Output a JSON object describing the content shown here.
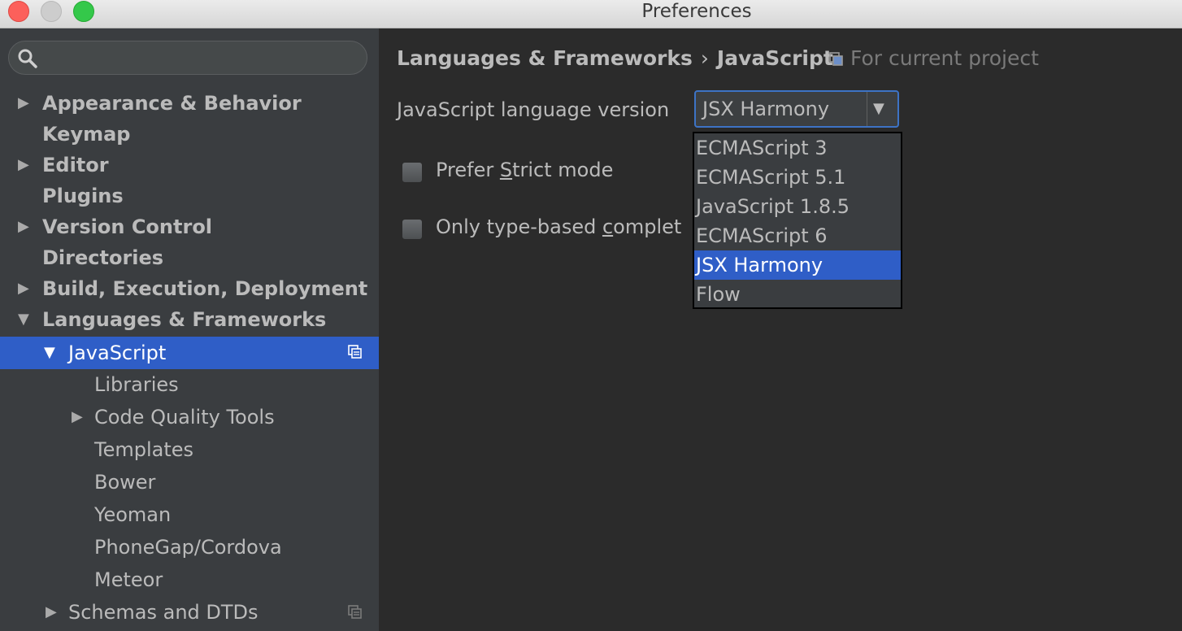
{
  "window": {
    "title": "Preferences"
  },
  "search": {
    "placeholder": ""
  },
  "sidebar": {
    "items": [
      {
        "label": "Appearance & Behavior",
        "arrow": "▶"
      },
      {
        "label": "Keymap",
        "arrow": ""
      },
      {
        "label": "Editor",
        "arrow": "▶"
      },
      {
        "label": "Plugins",
        "arrow": ""
      },
      {
        "label": "Version Control",
        "arrow": "▶"
      },
      {
        "label": "Directories",
        "arrow": ""
      },
      {
        "label": "Build, Execution, Deployment",
        "arrow": "▶"
      },
      {
        "label": "Languages & Frameworks",
        "arrow": "▼"
      },
      {
        "label": "JavaScript",
        "arrow": "▼",
        "selected": true
      },
      {
        "label": "Libraries",
        "arrow": ""
      },
      {
        "label": "Code Quality Tools",
        "arrow": "▶"
      },
      {
        "label": "Templates",
        "arrow": ""
      },
      {
        "label": "Bower",
        "arrow": ""
      },
      {
        "label": "Yeoman",
        "arrow": ""
      },
      {
        "label": "PhoneGap/Cordova",
        "arrow": ""
      },
      {
        "label": "Meteor",
        "arrow": ""
      },
      {
        "label": "Schemas and DTDs",
        "arrow": "▶"
      }
    ]
  },
  "main": {
    "breadcrumb": {
      "parent": "Languages & Frameworks",
      "separator": "›",
      "current": "JavaScript"
    },
    "scope_label": "For current project",
    "language_version": {
      "label": "JavaScript language version",
      "selected": "JSX Harmony",
      "options": [
        "ECMAScript 3",
        "ECMAScript 5.1",
        "JavaScript 1.8.5",
        "ECMAScript 6",
        "JSX Harmony",
        "Flow"
      ],
      "selected_index": 4
    },
    "checkboxes": [
      {
        "label_pre": "Prefer ",
        "mnemonic": "S",
        "label_post": "trict mode",
        "checked": false
      },
      {
        "label_pre": "Only type-based ",
        "mnemonic": "c",
        "label_post": "omplet",
        "checked": false
      }
    ]
  },
  "colors": {
    "selection": "#2f5ec7",
    "sidebar_bg": "#3a3d40",
    "panel_bg": "#2b2b2b",
    "text": "#bbbbbb",
    "focus_border": "#3d73c5"
  },
  "icons": {
    "search": "search-icon",
    "project_scope": "project-scope-icon",
    "expand": "chevron-right-icon",
    "collapse": "chevron-down-icon",
    "combo_arrow": "dropdown-arrow-icon"
  }
}
